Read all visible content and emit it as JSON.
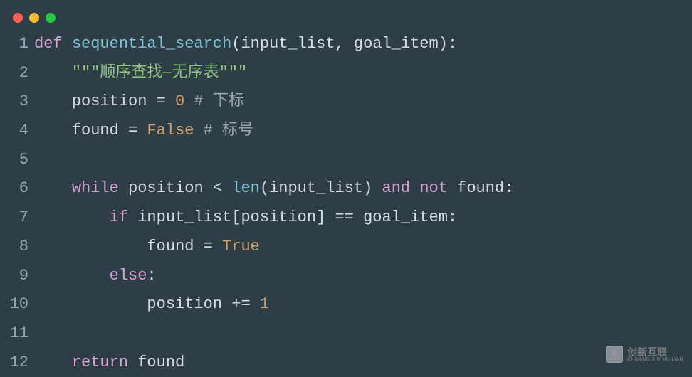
{
  "window": {
    "controls": [
      "close",
      "minimize",
      "zoom"
    ]
  },
  "code": {
    "lines": [
      {
        "num": "1",
        "tokens": [
          {
            "cls": "kw",
            "text": "def"
          },
          {
            "cls": "txt",
            "text": " "
          },
          {
            "cls": "fn",
            "text": "sequential_search"
          },
          {
            "cls": "txt",
            "text": "(input_list, goal_item):"
          }
        ]
      },
      {
        "num": "2",
        "tokens": [
          {
            "cls": "txt",
            "text": "    "
          },
          {
            "cls": "str",
            "text": "\"\"\"顺序查找—无序表\"\"\""
          }
        ]
      },
      {
        "num": "3",
        "tokens": [
          {
            "cls": "txt",
            "text": "    position = "
          },
          {
            "cls": "num",
            "text": "0"
          },
          {
            "cls": "txt",
            "text": " "
          },
          {
            "cls": "cmt",
            "text": "# 下标"
          }
        ]
      },
      {
        "num": "4",
        "tokens": [
          {
            "cls": "txt",
            "text": "    found = "
          },
          {
            "cls": "bool",
            "text": "False"
          },
          {
            "cls": "txt",
            "text": " "
          },
          {
            "cls": "cmt",
            "text": "# 标号"
          }
        ]
      },
      {
        "num": "5",
        "tokens": [
          {
            "cls": "txt",
            "text": ""
          }
        ]
      },
      {
        "num": "6",
        "tokens": [
          {
            "cls": "txt",
            "text": "    "
          },
          {
            "cls": "kw",
            "text": "while"
          },
          {
            "cls": "txt",
            "text": " position < "
          },
          {
            "cls": "builtin",
            "text": "len"
          },
          {
            "cls": "txt",
            "text": "(input_list) "
          },
          {
            "cls": "kw",
            "text": "and"
          },
          {
            "cls": "txt",
            "text": " "
          },
          {
            "cls": "kw",
            "text": "not"
          },
          {
            "cls": "txt",
            "text": " found:"
          }
        ]
      },
      {
        "num": "7",
        "tokens": [
          {
            "cls": "txt",
            "text": "        "
          },
          {
            "cls": "kw",
            "text": "if"
          },
          {
            "cls": "txt",
            "text": " input_list[position] == goal_item:"
          }
        ]
      },
      {
        "num": "8",
        "tokens": [
          {
            "cls": "txt",
            "text": "            found = "
          },
          {
            "cls": "bool",
            "text": "True"
          }
        ]
      },
      {
        "num": "9",
        "tokens": [
          {
            "cls": "txt",
            "text": "        "
          },
          {
            "cls": "kw",
            "text": "else"
          },
          {
            "cls": "txt",
            "text": ":"
          }
        ]
      },
      {
        "num": "10",
        "tokens": [
          {
            "cls": "txt",
            "text": "            position += "
          },
          {
            "cls": "num",
            "text": "1"
          }
        ]
      },
      {
        "num": "11",
        "tokens": [
          {
            "cls": "txt",
            "text": ""
          }
        ]
      },
      {
        "num": "12",
        "tokens": [
          {
            "cls": "txt",
            "text": "    "
          },
          {
            "cls": "kw",
            "text": "return"
          },
          {
            "cls": "txt",
            "text": " found"
          }
        ]
      }
    ]
  },
  "watermark": {
    "icon_letter": "X",
    "cn": "创新互联",
    "en": "CHUANG XIN HU LIAN"
  }
}
